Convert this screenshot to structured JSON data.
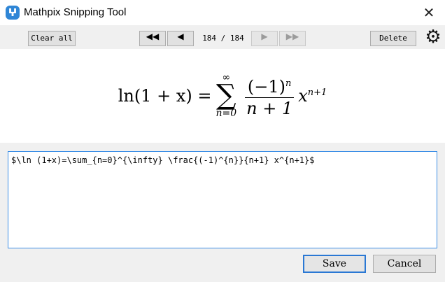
{
  "window": {
    "title": "Mathpix Snipping Tool",
    "icon": "mathpix-logo-icon",
    "close_glyph": "✕"
  },
  "toolbar": {
    "clear_all": "Clear all",
    "first_glyph": "◀◀",
    "prev_glyph": "◀",
    "next_glyph": "▶",
    "last_glyph": "▶▶",
    "counter": "184 / 184",
    "delete": "Delete",
    "settings_glyph": "⚙"
  },
  "preview": {
    "lhs": "ln(1 + x) =",
    "sum_upper": "∞",
    "sum_symbol": "∑",
    "sum_lower": "n=0",
    "numerator_base": "(−1)",
    "numerator_exp": "n",
    "denominator": "n + 1",
    "tail_base": "x",
    "tail_exp": "n+1"
  },
  "editor": {
    "value": "$\\ln (1+x)=\\sum_{n=0}^{\\infty} \\frac{(-1)^{n}}{n+1} x^{n+1}$"
  },
  "footer": {
    "save": "Save",
    "cancel": "Cancel"
  },
  "colors": {
    "accent": "#2a78d4",
    "icon_blue": "#2f86d6"
  }
}
